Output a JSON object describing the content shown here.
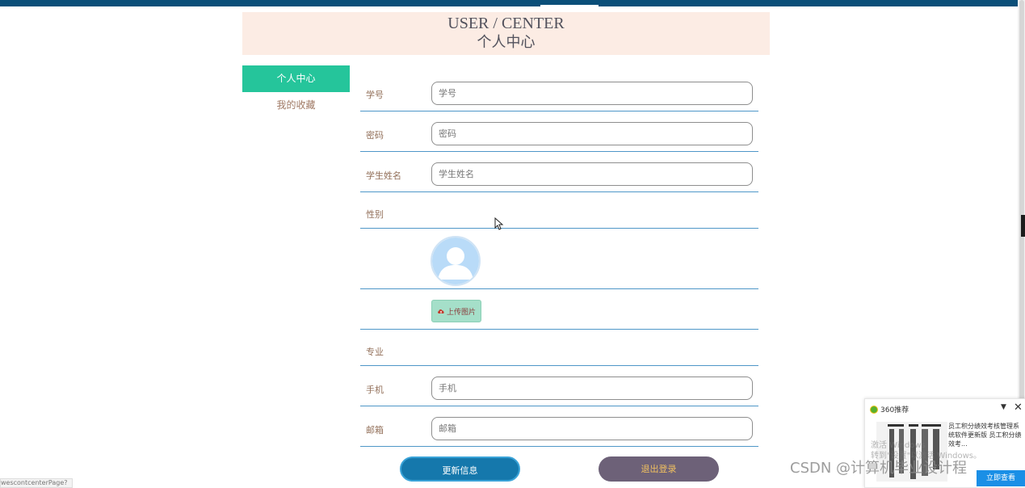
{
  "header": {
    "title_en": "USER / CENTER",
    "title_zh": "个人中心"
  },
  "sidebar": {
    "items": [
      {
        "label": "个人中心",
        "active": true
      },
      {
        "label": "我的收藏",
        "active": false
      }
    ]
  },
  "form": {
    "student_id": {
      "label": "学号",
      "placeholder": "学号"
    },
    "password": {
      "label": "密码",
      "placeholder": "密码"
    },
    "student_name": {
      "label": "学生姓名",
      "placeholder": "学生姓名"
    },
    "gender": {
      "label": "性别"
    },
    "upload_label": "上传图片",
    "major": {
      "label": "专业"
    },
    "phone": {
      "label": "手机",
      "placeholder": "手机"
    },
    "email": {
      "label": "邮箱",
      "placeholder": "邮箱"
    }
  },
  "actions": {
    "update_label": "更新信息",
    "logout_label": "退出登录"
  },
  "status_url": "wescontcenterPage?",
  "popup": {
    "title": "360推荐",
    "dropdown": "▼",
    "close": "✕",
    "description": "员工积分绩效考核管理系统软件更新版 员工积分绩效考...",
    "action_label": "立即查看"
  },
  "watermarks": {
    "activate_line1": "激活 Windows",
    "activate_line2": "转到\"设置\"以激活 Windows。",
    "csdn": "CSDN @计算机毕业设计程"
  },
  "colors": {
    "topbar": "#0b4f79",
    "active_sidebar": "#25c59b",
    "update_button": "#1578ac",
    "logout_button": "#6d6178"
  }
}
